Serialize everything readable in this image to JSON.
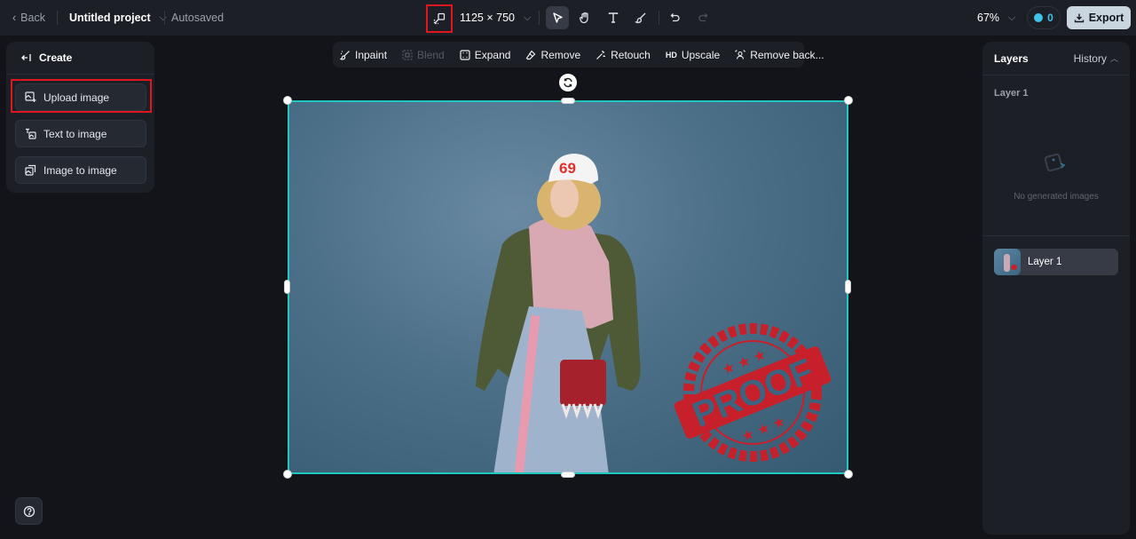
{
  "topbar": {
    "back_label": "Back",
    "project_name": "Untitled project",
    "save_status": "Autosaved",
    "canvas_size": "1125 × 750",
    "zoom_level": "67%",
    "credits": "0",
    "export_label": "Export",
    "tools": [
      {
        "name": "select",
        "icon": "cursor-icon",
        "active": true
      },
      {
        "name": "hand",
        "icon": "hand-icon",
        "active": false
      },
      {
        "name": "text",
        "icon": "text-icon",
        "active": false
      },
      {
        "name": "brush",
        "icon": "brush-icon",
        "active": false
      },
      {
        "name": "undo",
        "icon": "undo-icon",
        "active": false
      },
      {
        "name": "redo",
        "icon": "redo-icon",
        "active": false,
        "disabled": true
      }
    ]
  },
  "left_panel": {
    "title": "Create",
    "items": [
      {
        "label": "Upload image",
        "icon": "upload-image-icon",
        "highlighted": true
      },
      {
        "label": "Text to image",
        "icon": "text-to-image-icon"
      },
      {
        "label": "Image to image",
        "icon": "image-to-image-icon"
      }
    ]
  },
  "action_bar": {
    "items": [
      {
        "label": "Inpaint",
        "icon": "inpaint-icon",
        "disabled": false
      },
      {
        "label": "Blend",
        "icon": "blend-icon",
        "disabled": true
      },
      {
        "label": "Expand",
        "icon": "expand-icon",
        "disabled": false
      },
      {
        "label": "Remove",
        "icon": "eraser-icon",
        "disabled": false
      },
      {
        "label": "Retouch",
        "icon": "magic-wand-icon",
        "disabled": false
      },
      {
        "label": "Upscale",
        "icon": "hd-icon",
        "icon_text": "HD",
        "disabled": false
      },
      {
        "label": "Remove back...",
        "icon": "remove-background-icon",
        "disabled": false
      }
    ]
  },
  "canvas": {
    "image_description": "Woman in white 69 cap, pink sweater, olive bomber jacket and denim skirt against blue backdrop with red PROOF stamp",
    "stamp_text": "PROOF",
    "cap_text": "69",
    "selection_color": "#1fc7c1"
  },
  "right_panel": {
    "title": "Layers",
    "history_label": "History",
    "section_label": "Layer 1",
    "empty_text": "No generated images",
    "layers": [
      {
        "name": "Layer 1"
      }
    ]
  },
  "colors": {
    "accent": "#1fc7c1",
    "highlight_box": "#e0161e",
    "credits": "#3fc1e8",
    "export_bg": "#c9d6e0"
  }
}
